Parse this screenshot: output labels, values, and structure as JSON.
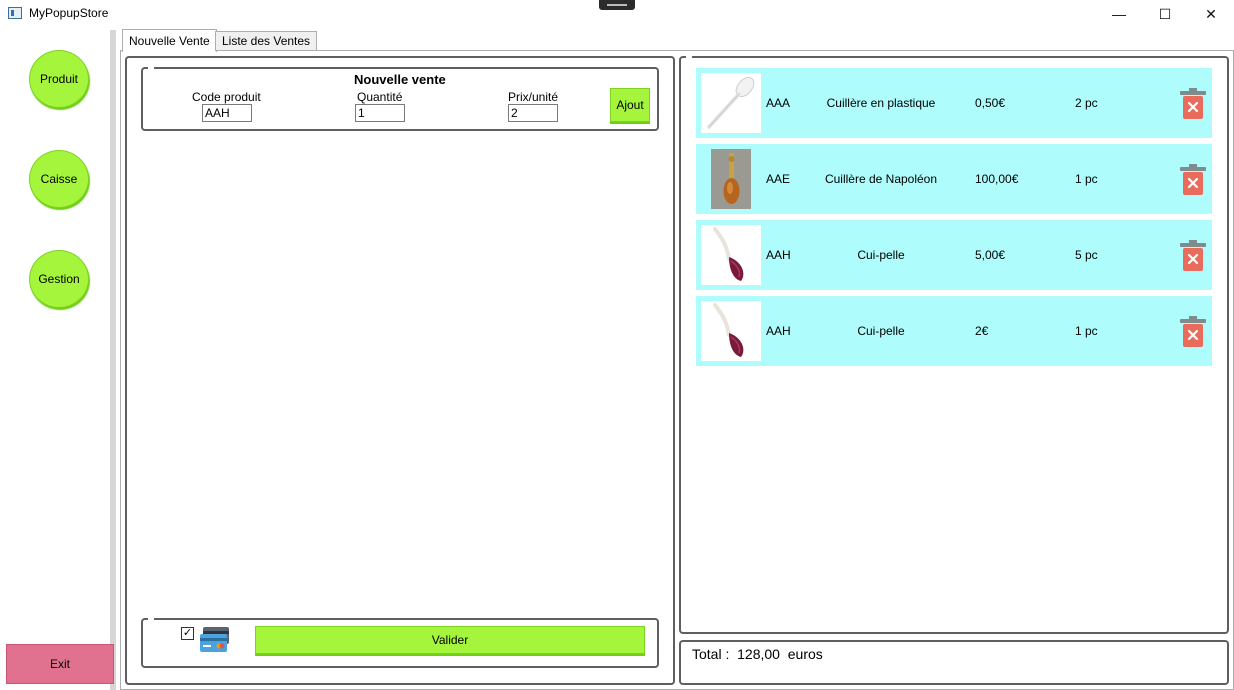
{
  "window": {
    "title": "MyPopupStore",
    "controls": {
      "minimize": "—",
      "maximize": "☐",
      "close": "✕"
    }
  },
  "sidebar": {
    "buttons": [
      {
        "label": "Produit"
      },
      {
        "label": "Caisse"
      },
      {
        "label": "Gestion"
      }
    ],
    "exit_label": "Exit"
  },
  "tabs": [
    {
      "label": "Nouvelle Vente",
      "active": true
    },
    {
      "label": "Liste des Ventes",
      "active": false
    }
  ],
  "nouvelle_vente": {
    "title": "Nouvelle vente",
    "code_label": "Code produit",
    "code_value": "AAH",
    "quantite_label": "Quantité",
    "quantite_value": "1",
    "prix_label": "Prix/unité",
    "prix_value": "2",
    "ajout_label": "Ajout"
  },
  "payment": {
    "card_checked": true,
    "valider_label": "Valider"
  },
  "items": [
    {
      "code": "AAA",
      "name": "Cuillère en plastique",
      "price": "0,50€",
      "qty": "2 pc",
      "thumb": "plastic-spoon"
    },
    {
      "code": "AAE",
      "name": "Cuillère de Napoléon",
      "price": "100,00€",
      "qty": "1 pc",
      "thumb": "napoleon-spoon"
    },
    {
      "code": "AAH",
      "name": "Cui-pelle",
      "price": "5,00€",
      "qty": "5 pc",
      "thumb": "cui-pelle"
    },
    {
      "code": "AAH",
      "name": "Cui-pelle",
      "price": "2€",
      "qty": "1 pc",
      "thumb": "cui-pelle"
    }
  ],
  "total": {
    "label": "Total :",
    "value": "128,00",
    "unit": "euros"
  },
  "colors": {
    "green": "#a5f53d",
    "row_bg": "#aefcfc",
    "exit": "#e0728f",
    "trash": "#e86b5b"
  }
}
